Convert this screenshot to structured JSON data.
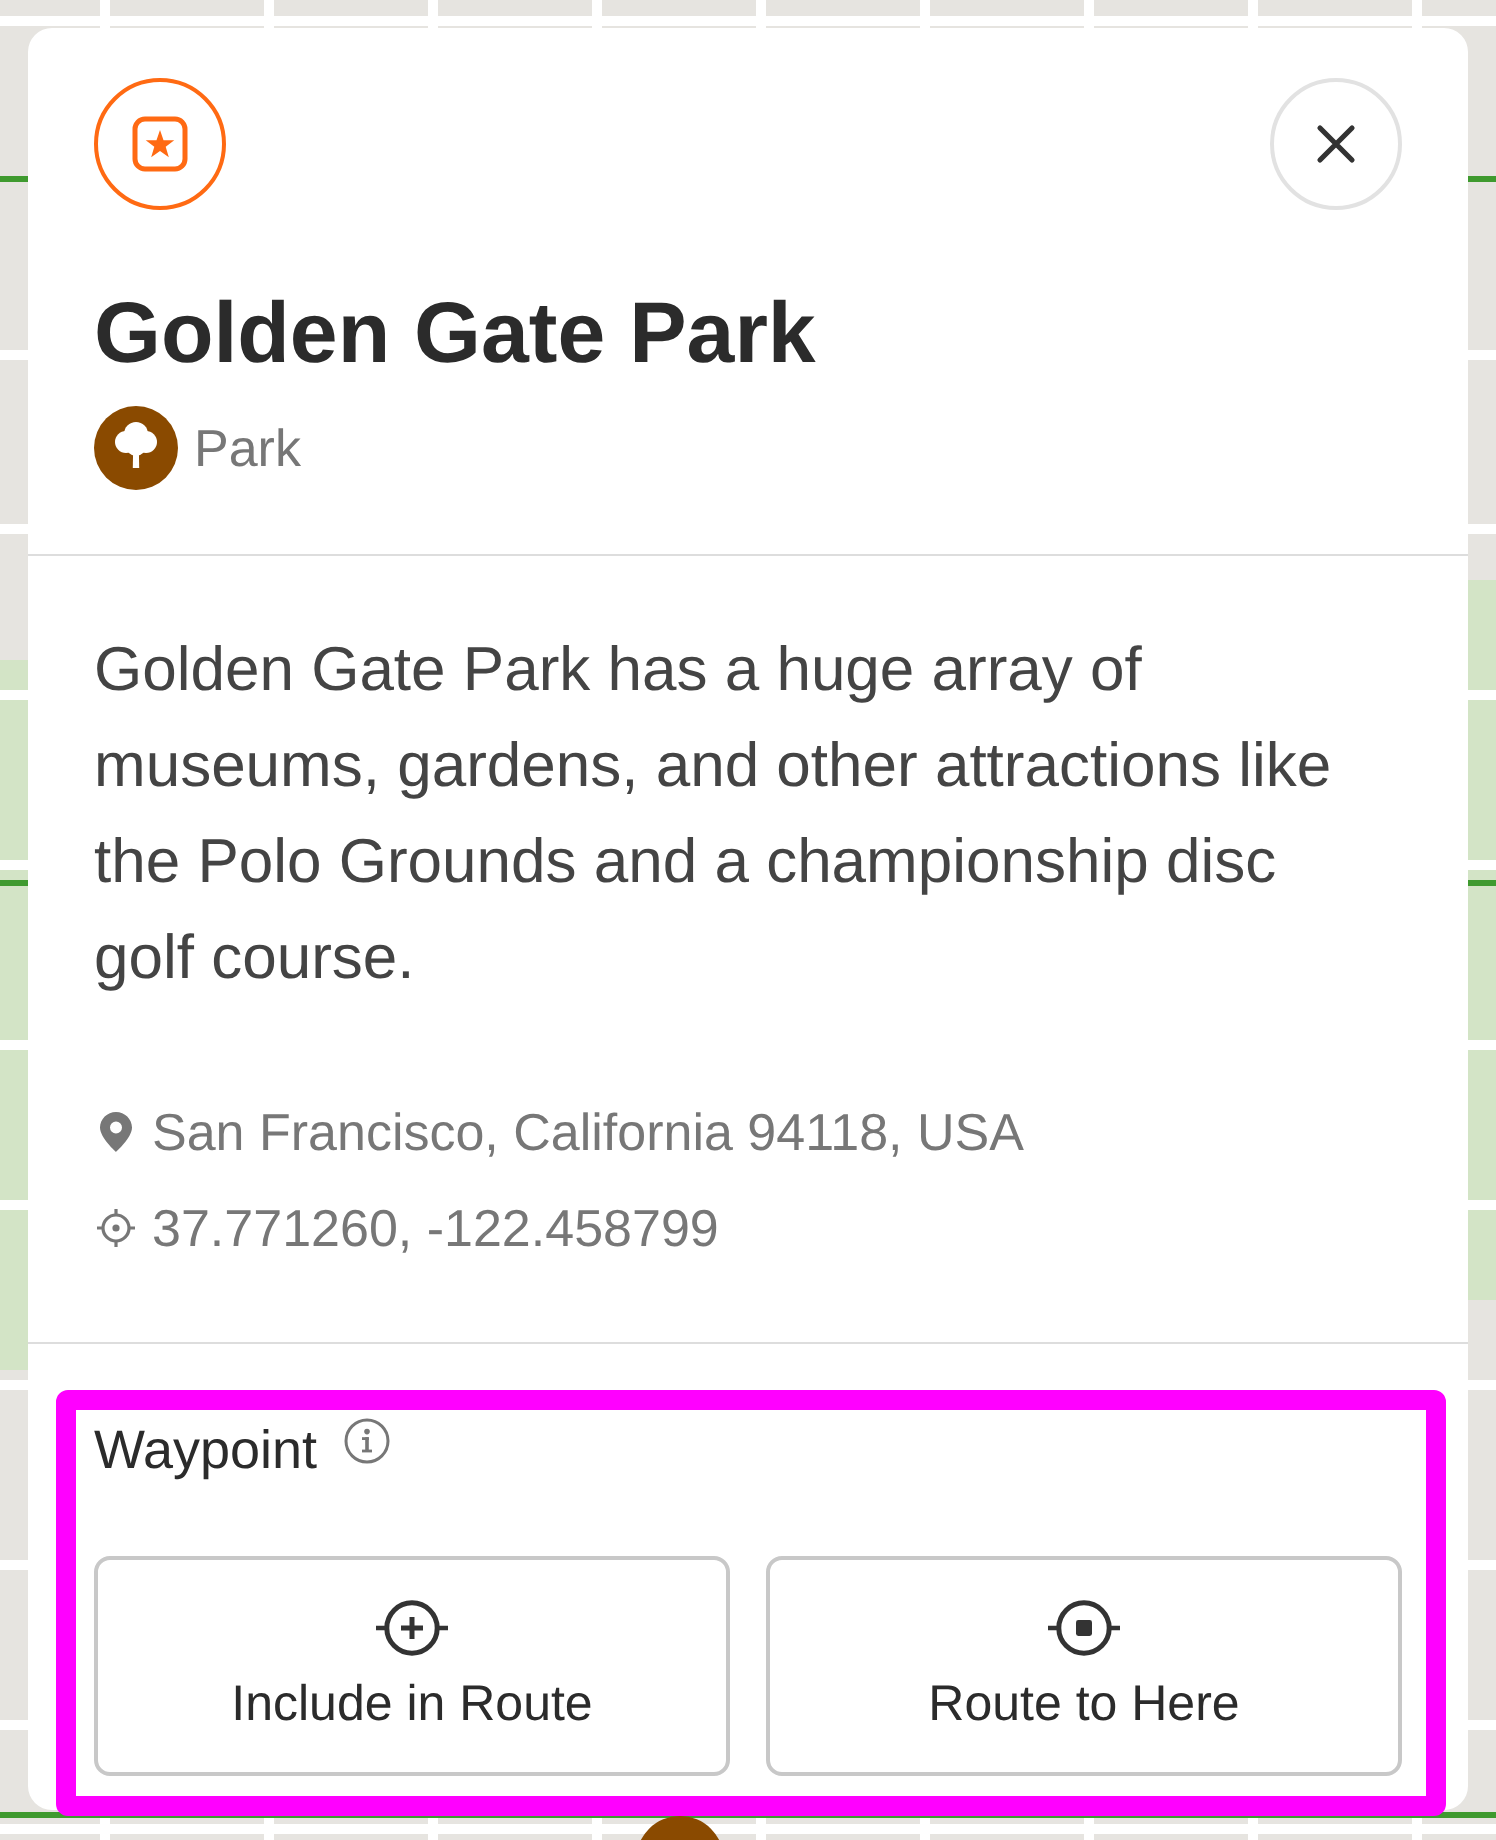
{
  "header": {
    "title": "Golden Gate Park",
    "category": {
      "label": "Park",
      "kind": "park"
    }
  },
  "description": "Golden Gate Park has a huge array of museums, gardens, and other attractions like the Polo Grounds and a championship disc golf course.",
  "details": [
    {
      "kind": "address",
      "text": "San Francisco, California 94118, USA"
    },
    {
      "kind": "coordinates",
      "text": "37.771260, -122.458799"
    }
  ],
  "waypoint": {
    "title": "Waypoint",
    "highlighted": true,
    "actions": [
      {
        "kind": "include",
        "label": "Include in Route"
      },
      {
        "kind": "destination",
        "label": "Route to Here"
      }
    ]
  }
}
